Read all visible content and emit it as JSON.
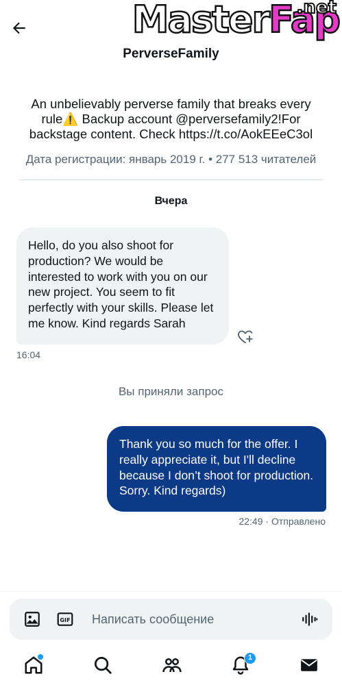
{
  "header": {
    "watermark_main": "Master",
    "watermark_accent": "Fap",
    "watermark_tld": ".net",
    "username": "PerverseFamily"
  },
  "profile": {
    "bio": "An unbelievably perverse family that breaks every rule⚠️ Backup account @perversefamily2!For backstage content. Check https://t.co/AokEEeC3ol",
    "meta": "Дата регистрации: январь 2019 г. • 277 513 читателей"
  },
  "conversation": {
    "date_separator": "Вчера",
    "messages": [
      {
        "direction": "incoming",
        "text": "Hello, do you also shoot for production? We would be interested to work with you on our new project. You seem to fit perfectly with your skills.  Please let me know. Kind regards Sarah",
        "time": "16:04"
      },
      {
        "direction": "outgoing",
        "text": "Thank you so much for the offer. I really appreciate it, but I'll decline because I don’t shoot for production. Sorry. Kind regards)",
        "time": "22:49 · Отправлено"
      }
    ],
    "system_note": "Вы приняли запрос"
  },
  "composer": {
    "placeholder": "Написать сообщение",
    "icons": [
      "image-icon",
      "gif-icon",
      "voice-icon"
    ]
  },
  "nav": {
    "items": [
      "home-icon",
      "search-icon",
      "communities-icon",
      "notifications-icon",
      "messages-icon"
    ],
    "notifications_badge": "1"
  },
  "colors": {
    "outgoing_bubble": "#0c3a86",
    "incoming_bubble": "#eff3f4",
    "accent": "#1d9bf0",
    "secondary_text": "#536471"
  }
}
